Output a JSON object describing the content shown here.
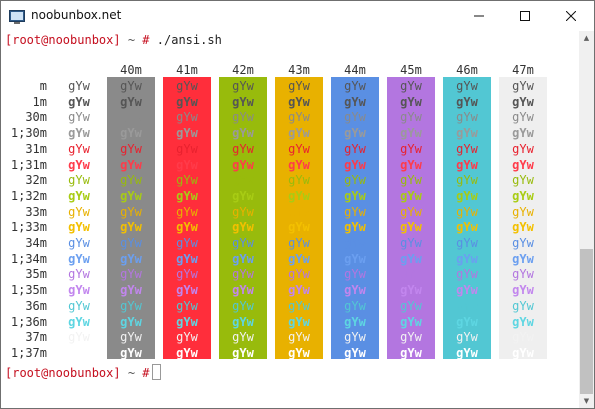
{
  "window": {
    "title": "noobunbox.net",
    "controls": {
      "minimize": "—",
      "maximize": "☐",
      "close": "✕"
    }
  },
  "prompt": {
    "user": "[root@noobunbox]",
    "tilde": "~",
    "hash": "#",
    "command": "./ansi.sh"
  },
  "ansi_table": {
    "sample": "gYw",
    "background_headers": [
      "40m",
      "41m",
      "42m",
      "43m",
      "44m",
      "45m",
      "46m",
      "47m"
    ],
    "row_labels": [
      "m",
      "1m",
      "30m",
      "1;30m",
      "31m",
      "1;31m",
      "32m",
      "1;32m",
      "33m",
      "1;33m",
      "34m",
      "1;34m",
      "35m",
      "1;35m",
      "36m",
      "1;36m",
      "37m",
      "1;37m"
    ],
    "background_colors": [
      "#8a8a8a",
      "#ff2e3b",
      "#98bb0c",
      "#e8b100",
      "#5a8fe3",
      "#b376e0",
      "#52c7d3",
      "#efefef"
    ],
    "foreground_colors": [
      "#555555",
      "#555555",
      "#8a8a8a",
      "#9a9a9a",
      "#e8212e",
      "#ff3b4a",
      "#98bb0c",
      "#a8cc14",
      "#e8b100",
      "#f3c000",
      "#5a8fe3",
      "#6b9ff0",
      "#b376e0",
      "#c286ee",
      "#52c7d3",
      "#5ed6e2",
      "#f2f2f2",
      "#ffffff"
    ]
  },
  "colors": {
    "prompt_user": "#c50f1f",
    "window_border": "#6f6f6f",
    "scroll_thumb": "#c1c1c1"
  }
}
